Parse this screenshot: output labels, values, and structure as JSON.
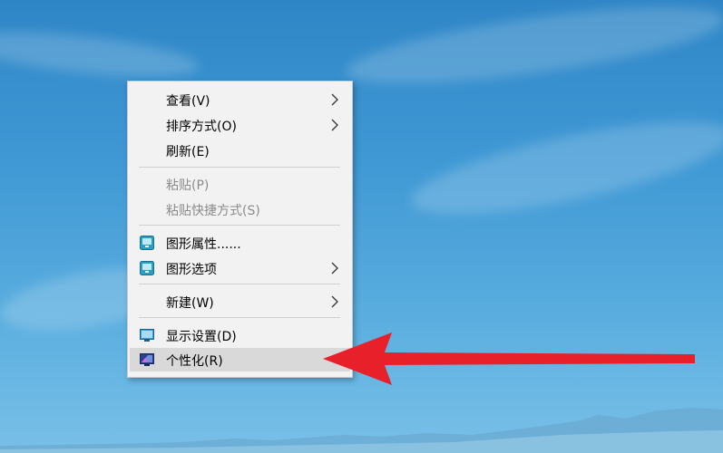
{
  "desktop": {
    "wallpaper_colors": [
      "#2f86c6",
      "#5aaedf",
      "#79c0e8"
    ]
  },
  "context_menu": {
    "items": [
      {
        "label": "查看(V)",
        "has_submenu": true,
        "enabled": true
      },
      {
        "label": "排序方式(O)",
        "has_submenu": true,
        "enabled": true
      },
      {
        "label": "刷新(E)",
        "has_submenu": false,
        "enabled": true
      },
      {
        "label": "粘贴(P)",
        "has_submenu": false,
        "enabled": false
      },
      {
        "label": "粘贴快捷方式(S)",
        "has_submenu": false,
        "enabled": false
      },
      {
        "label": "图形属性......",
        "has_submenu": false,
        "enabled": true,
        "icon": "graphics-icon"
      },
      {
        "label": "图形选项",
        "has_submenu": true,
        "enabled": true,
        "icon": "graphics-icon"
      },
      {
        "label": "新建(W)",
        "has_submenu": true,
        "enabled": true
      },
      {
        "label": "显示设置(D)",
        "has_submenu": false,
        "enabled": true,
        "icon": "display-icon"
      },
      {
        "label": "个性化(R)",
        "has_submenu": false,
        "enabled": true,
        "icon": "personalize-icon",
        "highlighted": true
      }
    ]
  },
  "annotation": {
    "arrow_color": "#e8202a"
  }
}
